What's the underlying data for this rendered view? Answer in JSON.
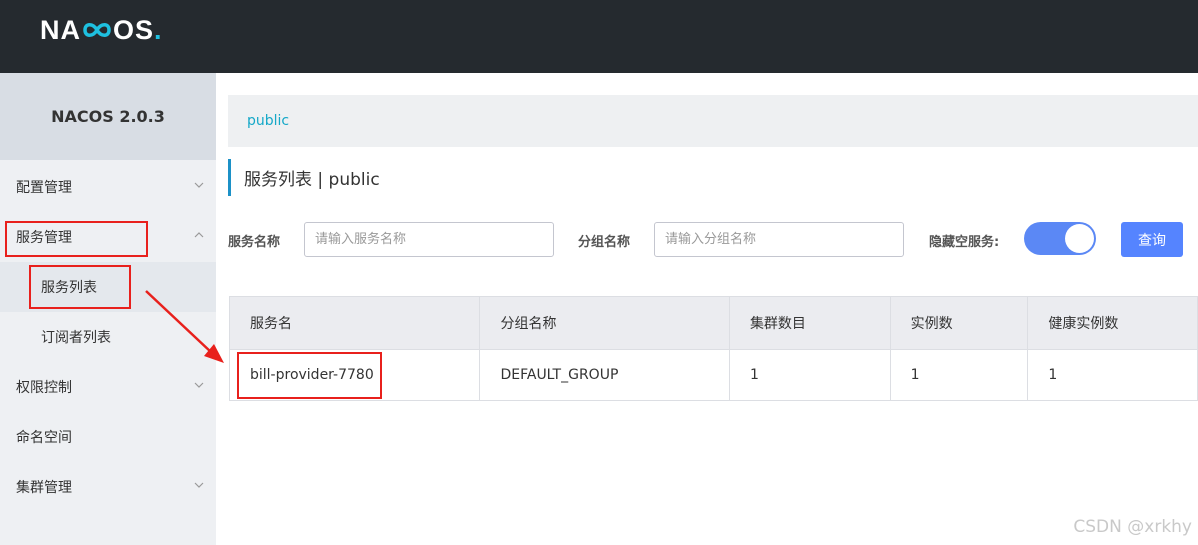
{
  "app": {
    "logo_text_1": "NA",
    "logo_text_2": "OS",
    "logo_dot": ".",
    "brand_color": "#1ec0e0"
  },
  "sidebar": {
    "title": "NACOS 2.0.3",
    "items": [
      {
        "label": "配置管理",
        "icon": "chevron-down-icon"
      },
      {
        "label": "服务管理",
        "icon": "chevron-up-icon"
      },
      {
        "label": "权限控制",
        "icon": "chevron-down-icon"
      },
      {
        "label": "命名空间"
      },
      {
        "label": "集群管理",
        "icon": "chevron-down-icon"
      }
    ],
    "sub_items": [
      {
        "label": "服务列表"
      },
      {
        "label": "订阅者列表"
      }
    ]
  },
  "breadcrumb": {
    "namespace": "public"
  },
  "page": {
    "title": "服务列表  |  public"
  },
  "filters": {
    "service_name_label": "服务名称",
    "service_name_placeholder": "请输入服务名称",
    "service_name_value": "",
    "group_name_label": "分组名称",
    "group_name_placeholder": "请输入分组名称",
    "group_name_value": "",
    "hide_empty_label": "隐藏空服务:",
    "hide_empty_on": true,
    "query_label": "查询"
  },
  "table": {
    "headers": [
      "服务名",
      "分组名称",
      "集群数目",
      "实例数",
      "健康实例数"
    ],
    "rows": [
      [
        "bill-provider-7780",
        "DEFAULT_GROUP",
        "1",
        "1",
        "1"
      ]
    ]
  },
  "annotation_color": "#e8201c",
  "watermark": "CSDN @xrkhy"
}
